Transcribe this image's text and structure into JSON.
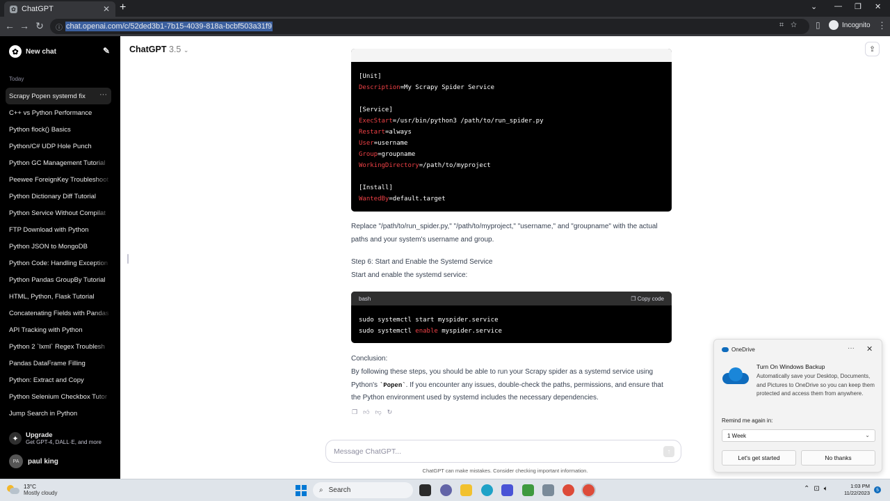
{
  "browser": {
    "tab_title": "ChatGPT",
    "url": "chat.openai.com/c/52ded3b1-7b15-4039-818a-bcbf503a31f9",
    "incognito_label": "Incognito"
  },
  "sidebar": {
    "new_chat": "New chat",
    "section": "Today",
    "items": [
      {
        "label": "Scrapy Popen systemd fix"
      },
      {
        "label": "C++ vs Python Performance"
      },
      {
        "label": "Python flock() Basics"
      },
      {
        "label": "Python/C# UDP Hole Punch"
      },
      {
        "label": "Python GC Management Tutorial"
      },
      {
        "label": "Peewee ForeignKey Troubleshoot"
      },
      {
        "label": "Python Dictionary Diff Tutorial"
      },
      {
        "label": "Python Service Without Compilat"
      },
      {
        "label": "FTP Download with Python"
      },
      {
        "label": "Python JSON to MongoDB"
      },
      {
        "label": "Python Code: Handling Exception"
      },
      {
        "label": "Python Pandas GroupBy Tutorial"
      },
      {
        "label": "HTML, Python, Flask Tutorial"
      },
      {
        "label": "Concatenating Fields with Pandas"
      },
      {
        "label": "API Tracking with Python"
      },
      {
        "label": "Python 2 `lxml` Regex Troublesh"
      },
      {
        "label": "Pandas DataFrame Filling"
      },
      {
        "label": "Python: Extract and Copy"
      },
      {
        "label": "Python Selenium Checkbox Tutor"
      },
      {
        "label": "Jump Search in Python"
      }
    ],
    "upgrade_title": "Upgrade",
    "upgrade_sub": "Get GPT-4, DALL·E, and more",
    "user_initials": "PA",
    "user_name": "paul king"
  },
  "header": {
    "model": "ChatGPT",
    "version": "3.5"
  },
  "unit_file": {
    "lines": [
      [
        {
          "t": "[Unit]"
        }
      ],
      [
        {
          "t": "Description",
          "k": true
        },
        {
          "t": "=My Scrapy Spider Service"
        }
      ],
      [
        {
          "t": ""
        }
      ],
      [
        {
          "t": "[Service]"
        }
      ],
      [
        {
          "t": "ExecStart",
          "k": true
        },
        {
          "t": "=/usr/bin/python3 /path/to/run_spider.py"
        }
      ],
      [
        {
          "t": "Restart",
          "k": true
        },
        {
          "t": "=always"
        }
      ],
      [
        {
          "t": "User",
          "k": true
        },
        {
          "t": "=username"
        }
      ],
      [
        {
          "t": "Group",
          "k": true
        },
        {
          "t": "=groupname"
        }
      ],
      [
        {
          "t": "WorkingDirectory",
          "k": true
        },
        {
          "t": "=/path/to/myproject"
        }
      ],
      [
        {
          "t": ""
        }
      ],
      [
        {
          "t": "[Install]"
        }
      ],
      [
        {
          "t": "WantedBy",
          "k": true
        },
        {
          "t": "=default.target"
        }
      ]
    ]
  },
  "message": {
    "replace_text": "Replace \"/path/to/run_spider.py,\" \"/path/to/myproject,\" \"username,\" and \"groupname\" with the actual paths and your system's username and group.",
    "step6_title": "Step 6: Start and Enable the Systemd Service",
    "step6_sub": "Start and enable the systemd service:",
    "bash_lang": "bash",
    "copy_label": "Copy code",
    "bash_lines": [
      [
        {
          "t": "sudo systemctl start myspider.service"
        }
      ],
      [
        {
          "t": "sudo systemctl "
        },
        {
          "t": "enable",
          "k": true
        },
        {
          "t": " myspider.service"
        }
      ]
    ],
    "conclusion_title": "Conclusion:",
    "conclusion_a": "By following these steps, you should be able to run your Scrapy spider as a systemd service using Python's ",
    "conclusion_code": "`Popen`",
    "conclusion_b": ". If you encounter any issues, double-check the paths, permissions, and ensure that the Python environment used by systemd includes the necessary dependencies."
  },
  "composer": {
    "placeholder": "Message ChatGPT...",
    "disclaimer": "ChatGPT can make mistakes. Consider checking important information."
  },
  "toast": {
    "app": "OneDrive",
    "title": "Turn On Windows Backup",
    "body": "Automatically save your Desktop, Documents, and Pictures to OneDrive so you can keep them protected and access them from anywhere.",
    "remind_label": "Remind me again in:",
    "remind_value": "1 Week",
    "primary": "Let's get started",
    "secondary": "No thanks"
  },
  "taskbar": {
    "temp": "13°C",
    "weather": "Mostly cloudy",
    "search": "Search",
    "time": "1:03 PM",
    "date": "11/22/2023",
    "notifications": "5"
  }
}
